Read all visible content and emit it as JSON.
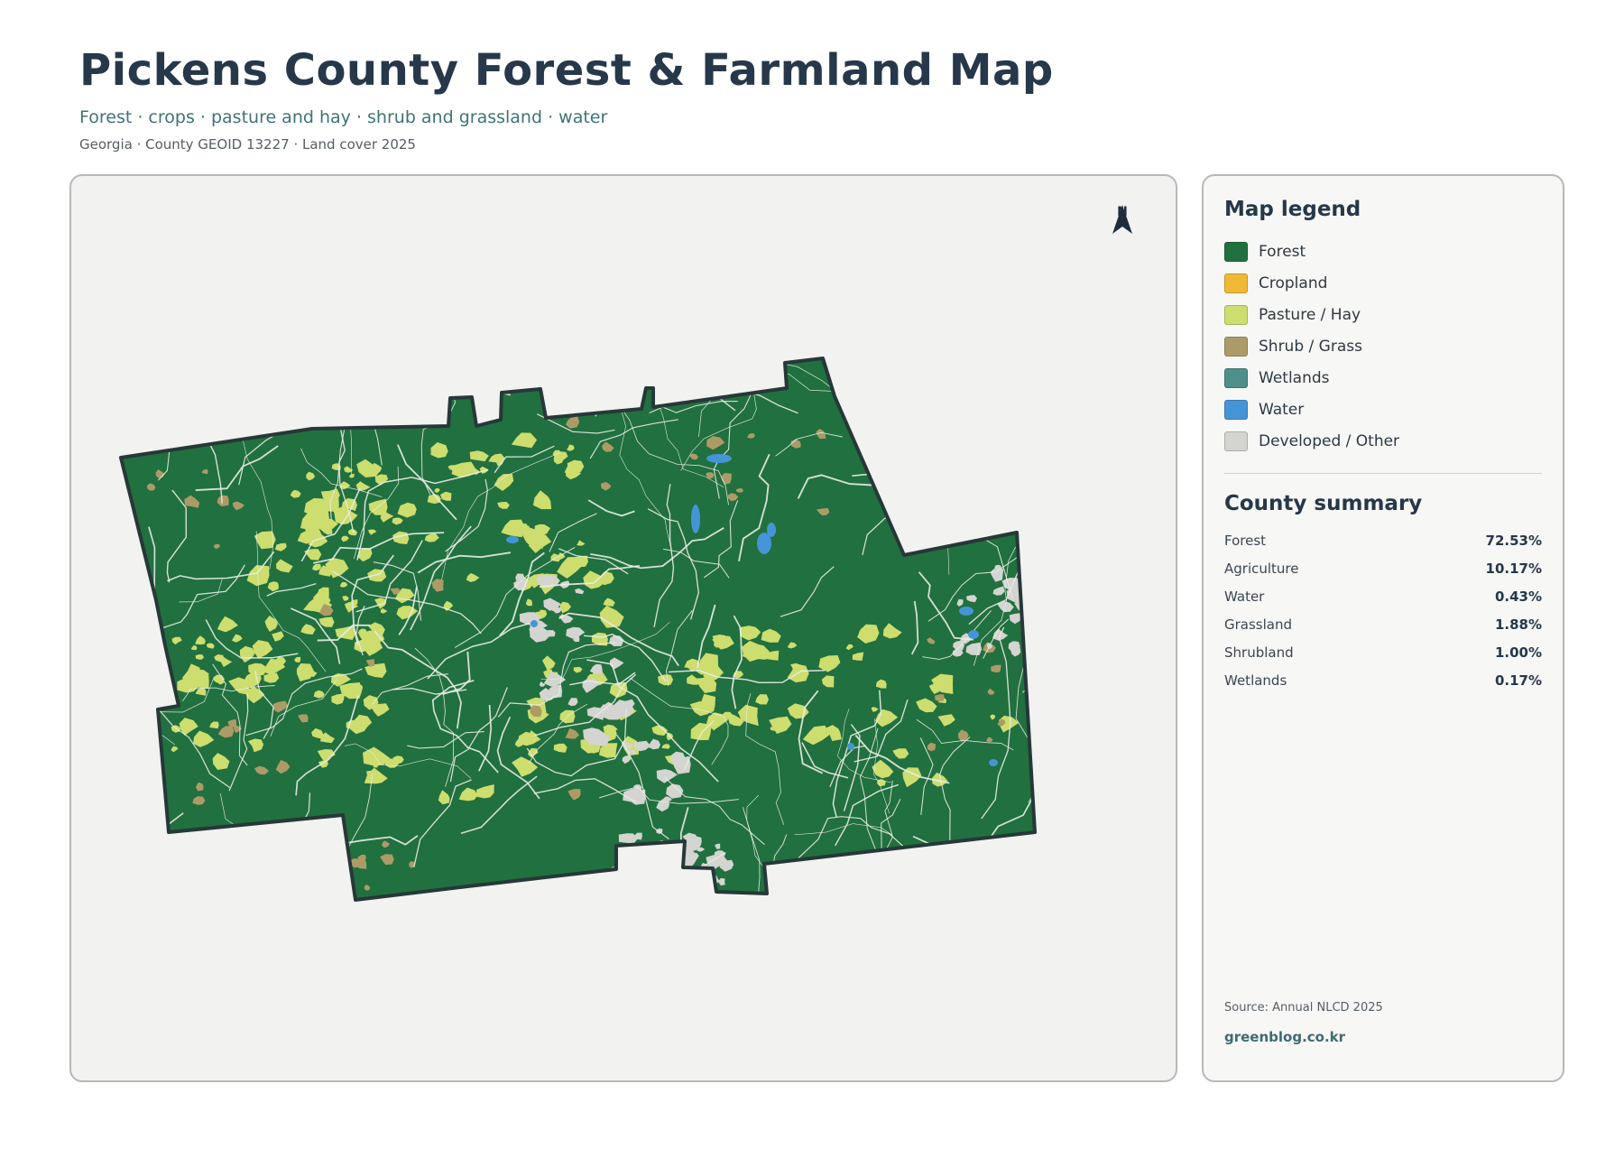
{
  "header": {
    "title": "Pickens County Forest & Farmland Map",
    "subtitle": "Forest · crops · pasture and hay · shrub and grassland · water",
    "meta": "Georgia · County GEOID 13227 · Land cover 2025"
  },
  "map": {
    "north_label": "N",
    "colors": {
      "forest": "#21703f",
      "cropland": "#f0b935",
      "pasture": "#cddd6e",
      "shrub": "#ad9b67",
      "wetlands": "#4e8f8c",
      "water": "#4595d6",
      "developed": "#d4d4d0",
      "outline": "#263838",
      "background": "#f2f2f0"
    }
  },
  "legend": {
    "title": "Map legend",
    "items": [
      {
        "label": "Forest",
        "color": "#21703f"
      },
      {
        "label": "Cropland",
        "color": "#f0b935"
      },
      {
        "label": "Pasture / Hay",
        "color": "#cddd6e"
      },
      {
        "label": "Shrub / Grass",
        "color": "#ad9b67"
      },
      {
        "label": "Wetlands",
        "color": "#4e8f8c"
      },
      {
        "label": "Water",
        "color": "#4595d6"
      },
      {
        "label": "Developed / Other",
        "color": "#d4d4d0"
      }
    ]
  },
  "summary": {
    "title": "County summary",
    "rows": [
      {
        "name": "Forest",
        "value": "72.53%"
      },
      {
        "name": "Agriculture",
        "value": "10.17%"
      },
      {
        "name": "Water",
        "value": "0.43%"
      },
      {
        "name": "Grassland",
        "value": "1.88%"
      },
      {
        "name": "Shrubland",
        "value": "1.00%"
      },
      {
        "name": "Wetlands",
        "value": "0.17%"
      }
    ]
  },
  "footer": {
    "source": "Source: Annual NLCD 2025",
    "site": "greenblog.co.kr"
  }
}
